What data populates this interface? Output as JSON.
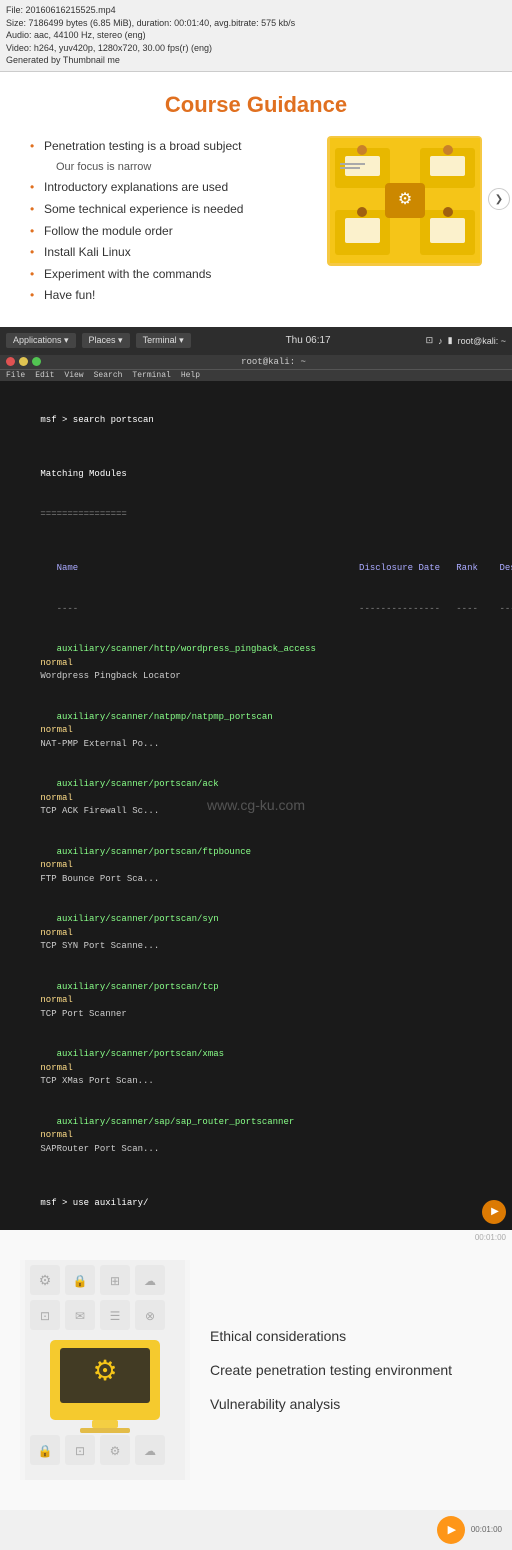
{
  "meta": {
    "filename": "File: 20160616215525.mp4",
    "size": "Size: 7186499 bytes (6.85 MiB), duration: 00:01:40, avg.bitrate: 575 kb/s",
    "audio": "Audio: aac, 44100 Hz, stereo (eng)",
    "video": "Video: h264, yuv420p, 1280x720, 30.00 fps(r) (eng)",
    "generator": "Generated by Thumbnail me"
  },
  "slide": {
    "title": "Course Guidance",
    "bullets": [
      "Penetration testing is a broad subject",
      "Our focus is narrow",
      "Introductory explanations are used",
      "Some technical experience is needed",
      "Follow the module order",
      "Install Kali Linux",
      "Experiment with the commands",
      "Have fun!"
    ]
  },
  "taskbar": {
    "app_label": "Applications ▾",
    "places_label": "Places ▾",
    "terminal_label": "Terminal ▾",
    "time": "Thu 06:17",
    "root_label": "root@kali: ~"
  },
  "terminal": {
    "title": "root@kali: ~",
    "menu_items": [
      "File",
      "Edit",
      "View",
      "Search",
      "Terminal",
      "Help"
    ],
    "command1": "msf > search portscan",
    "section_header": "Matching Modules",
    "separator": "================",
    "col_name": "Name",
    "col_disclosure": "Disclosure Date",
    "col_rank": "Rank",
    "col_desc": "Description",
    "col_sep": "----                                                    ----------------  ----  -----------",
    "modules": [
      {
        "name": "auxiliary/scanner/http/wordpress_pingback_access",
        "date": "",
        "rank": "normal",
        "desc": "Wordpress Pingback Locator"
      },
      {
        "name": "auxiliary/scanner/natpmp/natpmp_portscan",
        "date": "",
        "rank": "normal",
        "desc": "NAT-PMP External Port Scanner"
      },
      {
        "name": "auxiliary/scanner/portscan/ack",
        "date": "",
        "rank": "normal",
        "desc": "TCP ACK Firewall Scanner"
      },
      {
        "name": "auxiliary/scanner/portscan/ftpbounce",
        "date": "",
        "rank": "normal",
        "desc": "FTP Bounce Port Scanner"
      },
      {
        "name": "auxiliary/scanner/portscan/syn",
        "date": "",
        "rank": "normal",
        "desc": "TCP SYN Port Scanner"
      },
      {
        "name": "auxiliary/scanner/portscan/tcp",
        "date": "",
        "rank": "normal",
        "desc": "TCP Port Scanner"
      },
      {
        "name": "auxiliary/scanner/portscan/xmas",
        "date": "",
        "rank": "normal",
        "desc": "TCP XMas Port Scanner"
      },
      {
        "name": "auxiliary/scanner/sap/sap_router_portscanner",
        "date": "",
        "rank": "normal",
        "desc": "SAPRouter Port Scanner"
      }
    ],
    "command2": "msf > use auxiliary/",
    "watermark": "www.cg-ku.com",
    "time": "00:01:00"
  },
  "modules_section": {
    "items": [
      "Ethical considerations",
      "Create penetration testing environment",
      "Vulnerability analysis"
    ],
    "time": "00:01:00"
  },
  "nav": {
    "next_icon": "❯"
  }
}
